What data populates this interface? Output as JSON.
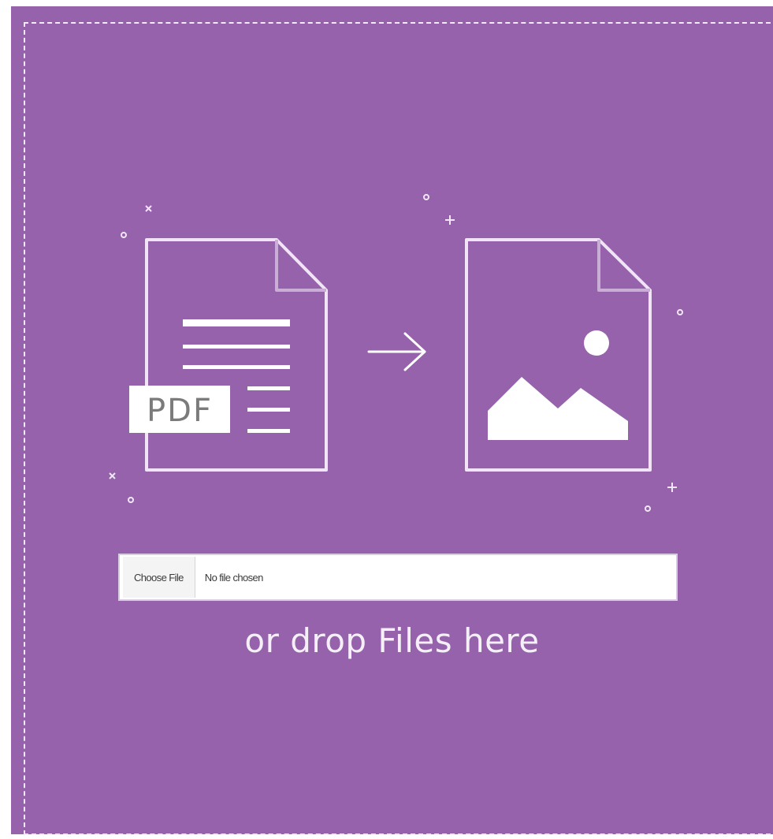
{
  "upload": {
    "choose_button_label": "Choose File",
    "file_status": "No file chosen",
    "drop_hint": "or drop Files here"
  },
  "illustration": {
    "source_badge": "PDF",
    "source_icon": "pdf-document-icon",
    "arrow_icon": "right-arrow-icon",
    "target_icon": "image-file-icon"
  },
  "colors": {
    "dropzone_background": "#9562ab",
    "dashed_border": "#f2eaf6",
    "line_art": "#ffffff"
  }
}
